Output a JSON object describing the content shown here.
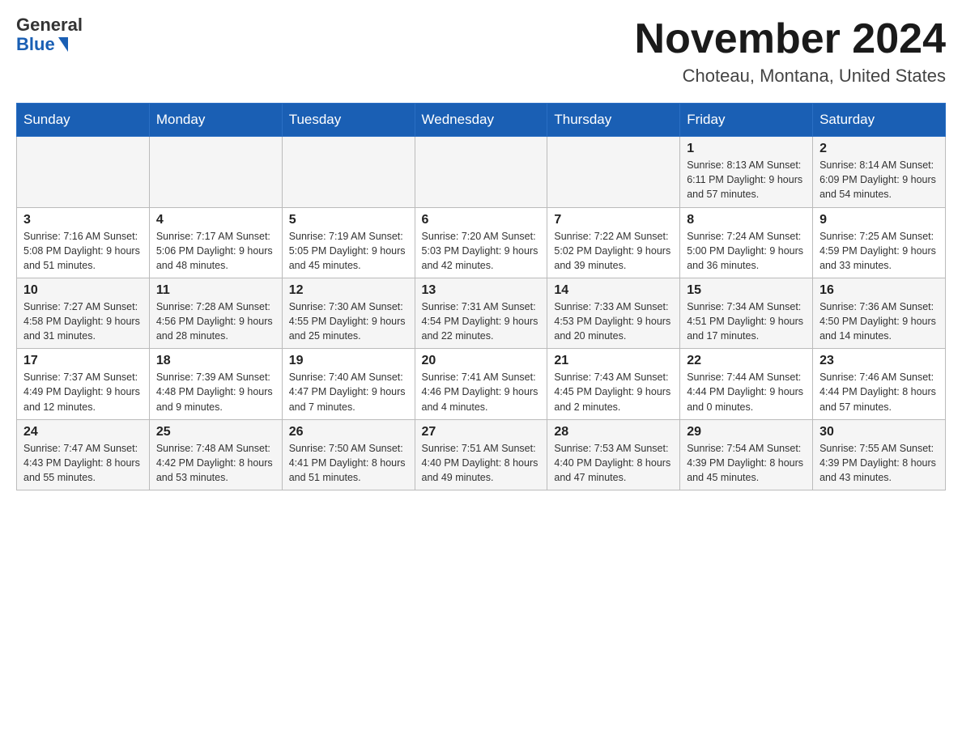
{
  "header": {
    "logo_general": "General",
    "logo_blue": "Blue",
    "month_title": "November 2024",
    "location": "Choteau, Montana, United States"
  },
  "weekdays": [
    "Sunday",
    "Monday",
    "Tuesday",
    "Wednesday",
    "Thursday",
    "Friday",
    "Saturday"
  ],
  "weeks": [
    [
      {
        "day": "",
        "info": ""
      },
      {
        "day": "",
        "info": ""
      },
      {
        "day": "",
        "info": ""
      },
      {
        "day": "",
        "info": ""
      },
      {
        "day": "",
        "info": ""
      },
      {
        "day": "1",
        "info": "Sunrise: 8:13 AM\nSunset: 6:11 PM\nDaylight: 9 hours and 57 minutes."
      },
      {
        "day": "2",
        "info": "Sunrise: 8:14 AM\nSunset: 6:09 PM\nDaylight: 9 hours and 54 minutes."
      }
    ],
    [
      {
        "day": "3",
        "info": "Sunrise: 7:16 AM\nSunset: 5:08 PM\nDaylight: 9 hours and 51 minutes."
      },
      {
        "day": "4",
        "info": "Sunrise: 7:17 AM\nSunset: 5:06 PM\nDaylight: 9 hours and 48 minutes."
      },
      {
        "day": "5",
        "info": "Sunrise: 7:19 AM\nSunset: 5:05 PM\nDaylight: 9 hours and 45 minutes."
      },
      {
        "day": "6",
        "info": "Sunrise: 7:20 AM\nSunset: 5:03 PM\nDaylight: 9 hours and 42 minutes."
      },
      {
        "day": "7",
        "info": "Sunrise: 7:22 AM\nSunset: 5:02 PM\nDaylight: 9 hours and 39 minutes."
      },
      {
        "day": "8",
        "info": "Sunrise: 7:24 AM\nSunset: 5:00 PM\nDaylight: 9 hours and 36 minutes."
      },
      {
        "day": "9",
        "info": "Sunrise: 7:25 AM\nSunset: 4:59 PM\nDaylight: 9 hours and 33 minutes."
      }
    ],
    [
      {
        "day": "10",
        "info": "Sunrise: 7:27 AM\nSunset: 4:58 PM\nDaylight: 9 hours and 31 minutes."
      },
      {
        "day": "11",
        "info": "Sunrise: 7:28 AM\nSunset: 4:56 PM\nDaylight: 9 hours and 28 minutes."
      },
      {
        "day": "12",
        "info": "Sunrise: 7:30 AM\nSunset: 4:55 PM\nDaylight: 9 hours and 25 minutes."
      },
      {
        "day": "13",
        "info": "Sunrise: 7:31 AM\nSunset: 4:54 PM\nDaylight: 9 hours and 22 minutes."
      },
      {
        "day": "14",
        "info": "Sunrise: 7:33 AM\nSunset: 4:53 PM\nDaylight: 9 hours and 20 minutes."
      },
      {
        "day": "15",
        "info": "Sunrise: 7:34 AM\nSunset: 4:51 PM\nDaylight: 9 hours and 17 minutes."
      },
      {
        "day": "16",
        "info": "Sunrise: 7:36 AM\nSunset: 4:50 PM\nDaylight: 9 hours and 14 minutes."
      }
    ],
    [
      {
        "day": "17",
        "info": "Sunrise: 7:37 AM\nSunset: 4:49 PM\nDaylight: 9 hours and 12 minutes."
      },
      {
        "day": "18",
        "info": "Sunrise: 7:39 AM\nSunset: 4:48 PM\nDaylight: 9 hours and 9 minutes."
      },
      {
        "day": "19",
        "info": "Sunrise: 7:40 AM\nSunset: 4:47 PM\nDaylight: 9 hours and 7 minutes."
      },
      {
        "day": "20",
        "info": "Sunrise: 7:41 AM\nSunset: 4:46 PM\nDaylight: 9 hours and 4 minutes."
      },
      {
        "day": "21",
        "info": "Sunrise: 7:43 AM\nSunset: 4:45 PM\nDaylight: 9 hours and 2 minutes."
      },
      {
        "day": "22",
        "info": "Sunrise: 7:44 AM\nSunset: 4:44 PM\nDaylight: 9 hours and 0 minutes."
      },
      {
        "day": "23",
        "info": "Sunrise: 7:46 AM\nSunset: 4:44 PM\nDaylight: 8 hours and 57 minutes."
      }
    ],
    [
      {
        "day": "24",
        "info": "Sunrise: 7:47 AM\nSunset: 4:43 PM\nDaylight: 8 hours and 55 minutes."
      },
      {
        "day": "25",
        "info": "Sunrise: 7:48 AM\nSunset: 4:42 PM\nDaylight: 8 hours and 53 minutes."
      },
      {
        "day": "26",
        "info": "Sunrise: 7:50 AM\nSunset: 4:41 PM\nDaylight: 8 hours and 51 minutes."
      },
      {
        "day": "27",
        "info": "Sunrise: 7:51 AM\nSunset: 4:40 PM\nDaylight: 8 hours and 49 minutes."
      },
      {
        "day": "28",
        "info": "Sunrise: 7:53 AM\nSunset: 4:40 PM\nDaylight: 8 hours and 47 minutes."
      },
      {
        "day": "29",
        "info": "Sunrise: 7:54 AM\nSunset: 4:39 PM\nDaylight: 8 hours and 45 minutes."
      },
      {
        "day": "30",
        "info": "Sunrise: 7:55 AM\nSunset: 4:39 PM\nDaylight: 8 hours and 43 minutes."
      }
    ]
  ]
}
